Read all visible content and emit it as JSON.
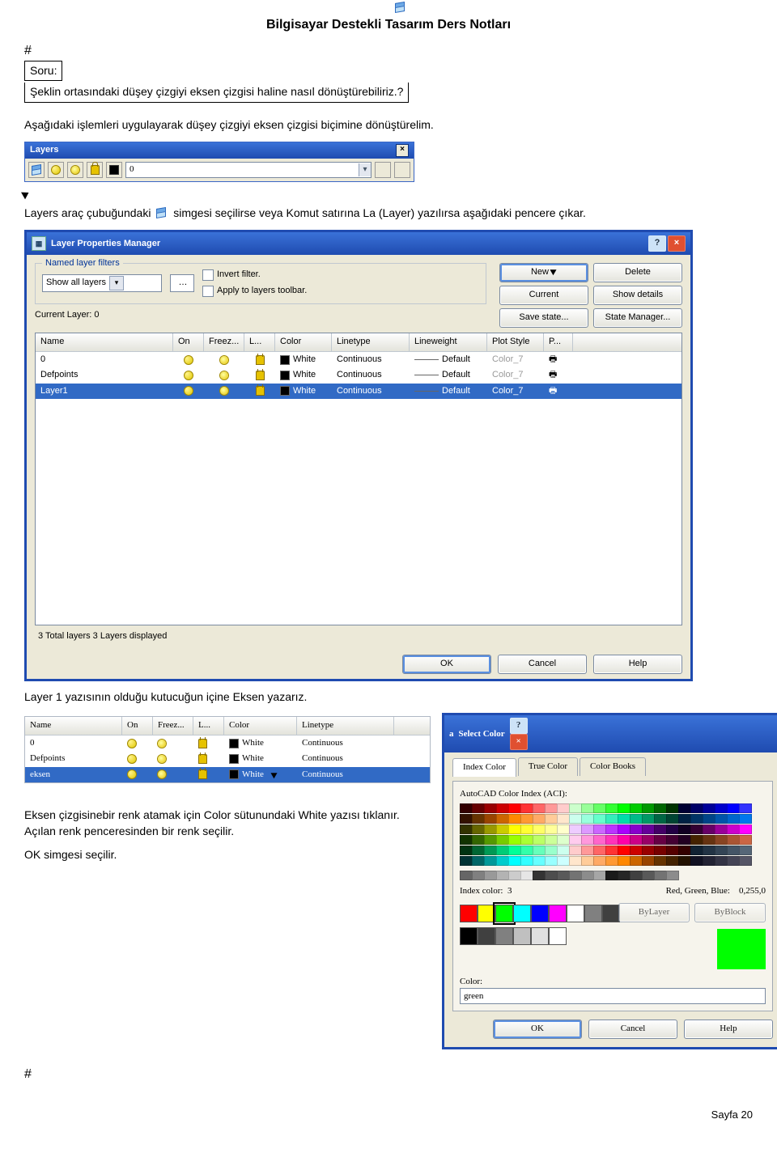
{
  "page_title": "Bilgisayar Destekli Tasarım Ders Notları",
  "hash": "#",
  "soru_label": "Soru:",
  "soru_text": "Şeklin ortasındaki düşey çizgiyi eksen çizgisi haline nasıl dönüştürebiliriz.?",
  "para1": "Aşağıdaki işlemleri uygulayarak  düşey çizgiyi eksen çizgisi biçimine dönüştürelim.",
  "layers_toolbar": {
    "title": "Layers",
    "selected": "0"
  },
  "para2_pre": "Layers araç çubuğundaki ",
  "para2_post": " simgesi seçilirse veya Komut satırına  La (Layer) yazılırsa aşağıdaki pencere çıkar.",
  "lpm": {
    "title": "Layer Properties Manager",
    "filters_legend": "Named layer filters",
    "filter_value": "Show all layers",
    "invert": "Invert filter.",
    "apply": "Apply to layers toolbar.",
    "new": "New",
    "delete": "Delete",
    "current": "Current",
    "details": "Show details",
    "save": "Save state...",
    "mgr": "State Manager...",
    "cur_label": "Current Layer:  0",
    "cols": {
      "name": "Name",
      "on": "On",
      "freez": "Freez...",
      "l": "L...",
      "color": "Color",
      "lt": "Linetype",
      "lw": "Lineweight",
      "ps": "Plot Style",
      "p": "P..."
    },
    "rows": [
      {
        "name": "0",
        "color": "White",
        "lt": "Continuous",
        "lw": "Default",
        "ps": "Color_7"
      },
      {
        "name": "Defpoints",
        "color": "White",
        "lt": "Continuous",
        "lw": "Default",
        "ps": "Color_7"
      },
      {
        "name": "Layer1",
        "color": "White",
        "lt": "Continuous",
        "lw": "Default",
        "ps": "Color_7"
      }
    ],
    "status": "3 Total layers     3 Layers displayed",
    "ok": "OK",
    "cancel": "Cancel",
    "help": "Help"
  },
  "para3": "Layer 1  yazısının olduğu kutucuğun içine Eksen yazarız.",
  "snip_rows": [
    {
      "name": "0",
      "color": "White",
      "lt": "Continuous"
    },
    {
      "name": "Defpoints",
      "color": "White",
      "lt": "Continuous"
    },
    {
      "name": "eksen",
      "color": "White",
      "lt": "Continuous"
    }
  ],
  "para4": "Eksen çizgisinebir renk atamak için Color sütunundaki White yazısı tıklanır. Açılan renk penceresinden bir renk seçilir.",
  "para5": "OK simgesi seçilir.",
  "sc": {
    "title": "Select Color",
    "tabs": {
      "index": "Index Color",
      "true": "True Color",
      "books": "Color Books"
    },
    "aci": "AutoCAD Color Index (ACI):",
    "idx_label": "Index color:",
    "idx_val": "3",
    "rgb_label": "Red, Green, Blue:",
    "rgb_val": "0,255,0",
    "bylayer": "ByLayer",
    "byblock": "ByBlock",
    "color_label": "Color:",
    "color_val": "green",
    "ok": "OK",
    "cancel": "Cancel",
    "help": "Help"
  },
  "pagefoot": "Sayfa 20",
  "palette_top": [
    "#330000",
    "#660000",
    "#990000",
    "#cc0000",
    "#ff0000",
    "#ff3333",
    "#ff6666",
    "#ff9999",
    "#ffcccc",
    "#ccffcc",
    "#99ff99",
    "#66ff66",
    "#33ff33",
    "#00ff00",
    "#00cc00",
    "#009900",
    "#006600",
    "#003300",
    "#000033",
    "#000066",
    "#000099",
    "#0000cc",
    "#0000ff",
    "#3333ff",
    "#331100",
    "#663300",
    "#994400",
    "#cc6600",
    "#ff8800",
    "#ff9933",
    "#ffaa66",
    "#ffcc99",
    "#ffe6cc",
    "#ccffee",
    "#99ffdd",
    "#66ffcc",
    "#33eebb",
    "#00ddaa",
    "#00bb88",
    "#009966",
    "#006644",
    "#004433",
    "#002244",
    "#003366",
    "#004488",
    "#0055aa",
    "#0066cc",
    "#0077ee",
    "#333300",
    "#666600",
    "#999900",
    "#cccc00",
    "#ffff00",
    "#ffff33",
    "#ffff66",
    "#ffff99",
    "#ffffcc",
    "#eeccff",
    "#dd99ff",
    "#cc66ff",
    "#bb33ff",
    "#aa00ff",
    "#8800cc",
    "#660099",
    "#440066",
    "#220044",
    "#110022",
    "#330033",
    "#660066",
    "#990099",
    "#cc00cc",
    "#ff00ff",
    "#113300",
    "#336600",
    "#559900",
    "#77cc00",
    "#99ff00",
    "#aaff33",
    "#bbff66",
    "#ccff99",
    "#ddffcc",
    "#ffccee",
    "#ff99dd",
    "#ff66cc",
    "#ff33bb",
    "#ff00aa",
    "#cc0088",
    "#990066",
    "#660044",
    "#440033",
    "#220022",
    "#442200",
    "#663311",
    "#884422",
    "#aa5533",
    "#cc6644",
    "#003311",
    "#006633",
    "#009955",
    "#00cc77",
    "#00ff99",
    "#33ffaa",
    "#66ffbb",
    "#99ffcc",
    "#ccffee",
    "#ffcccc",
    "#ff9999",
    "#ff6666",
    "#ff3333",
    "#ff0000",
    "#cc0000",
    "#990000",
    "#770000",
    "#550000",
    "#330000",
    "#112233",
    "#223344",
    "#334455",
    "#445566",
    "#556677",
    "#003333",
    "#006666",
    "#009999",
    "#00cccc",
    "#00ffff",
    "#33ffff",
    "#66ffff",
    "#99ffff",
    "#ccffff",
    "#ffe6cc",
    "#ffcc99",
    "#ffaa66",
    "#ff9933",
    "#ff8800",
    "#cc6600",
    "#994400",
    "#663300",
    "#442200",
    "#221100",
    "#111122",
    "#222233",
    "#333344",
    "#444455",
    "#555566"
  ],
  "palette_gray": [
    "#666666",
    "#808080",
    "#999999",
    "#b3b3b3",
    "#cccccc",
    "#e6e6e6",
    "#333333",
    "#4d4d4d",
    "#595959",
    "#737373",
    "#8c8c8c",
    "#a6a6a6",
    "#1a1a1a",
    "#262626",
    "#404040",
    "#595959",
    "#737373",
    "#8c8c8c"
  ],
  "std_colors": [
    "#ff0000",
    "#ffff00",
    "#00ff00",
    "#00ffff",
    "#0000ff",
    "#ff00ff",
    "#ffffff",
    "#808080",
    "#404040"
  ],
  "gray_row": [
    "#000000",
    "#404040",
    "#808080",
    "#c0c0c0",
    "#e0e0e0",
    "#ffffff"
  ]
}
